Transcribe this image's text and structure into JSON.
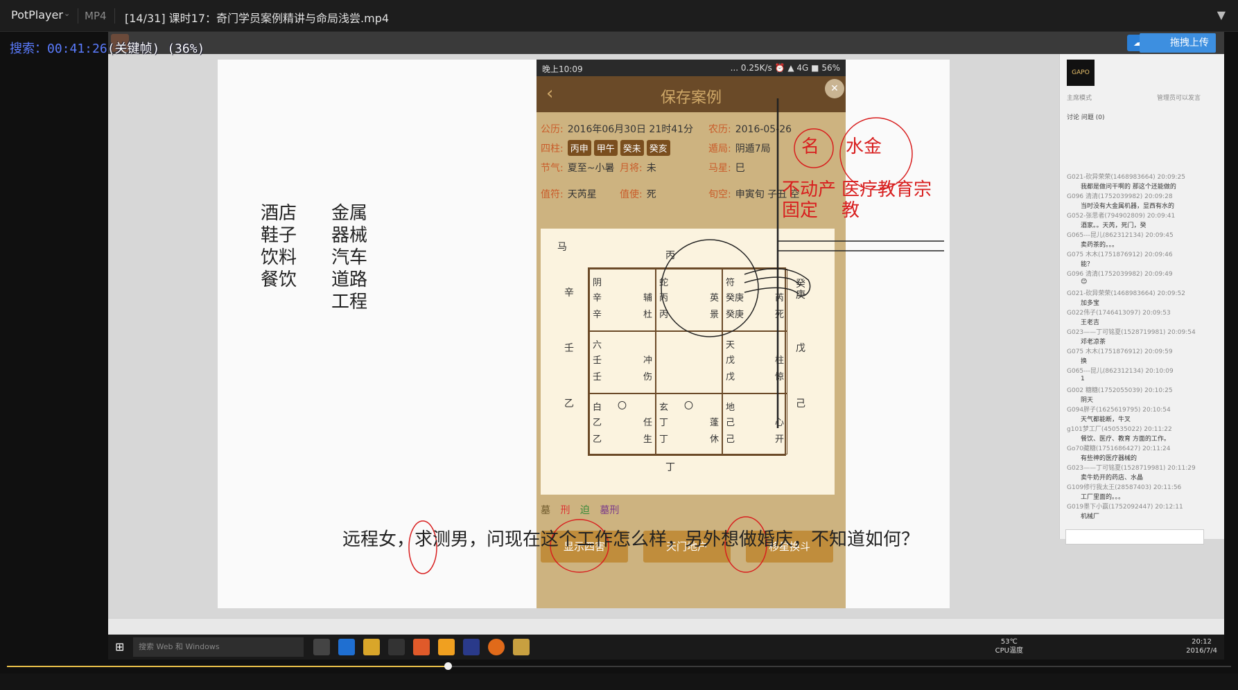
{
  "titlebar": {
    "app": "PotPlayer",
    "format": "MP4",
    "title": "[14/31] 课时17：奇门学员案例精讲与命局浅尝.mp4"
  },
  "search_overlay": {
    "label": "搜索：00:41:26",
    "status": "(关键帧) (36%)"
  },
  "video_topbar": {
    "upload_label": "拖拽上传"
  },
  "phone": {
    "status_time": "晚上10:09",
    "status_right": "... 0.25K/s ⏰ ▲ 4G ■ 56%",
    "header_title": "保存案例",
    "info": {
      "gongli_k": "公历:",
      "gongli_v": "2016年06月30日 21时41分",
      "nongli_k": "农历:",
      "nongli_v": "2016-05-26",
      "sizhu_k": "四柱:",
      "pillars": [
        "丙申",
        "甲午",
        "癸未",
        "癸亥"
      ],
      "dunju_k": "遁局:",
      "dunju_v": "阴遁7局",
      "jieqi_k": "节气:",
      "jieqi_v": "夏至~小暑",
      "yuejiang_k": "月将:",
      "yuejiang_v": "未",
      "maxing_k": "马星:",
      "maxing_v": "巳",
      "zhifu_k": "值符:",
      "zhifu_v": "天芮星",
      "zhishi_k": "值使:",
      "zhishi_v": "死",
      "xunkong_k": "旬空:",
      "xunkong_v": "申寅旬 子丑 空"
    },
    "board": {
      "ma": "马",
      "top": "丙",
      "bottom": "丁",
      "left": [
        "辛",
        "壬",
        "乙"
      ],
      "right": [
        "癸庚",
        "戊",
        "己"
      ],
      "cells": [
        [
          "阴",
          "辛",
          "辅",
          "辛",
          "杜"
        ],
        [
          "蛇",
          "丙",
          "英",
          "丙",
          "景"
        ],
        [
          "符",
          "癸庚",
          "芮",
          "癸庚",
          "死"
        ],
        [
          "六",
          "壬",
          "冲",
          "壬",
          "伤"
        ],
        [
          "",
          "",
          "",
          "",
          ""
        ],
        [
          "天",
          "戊",
          "柱",
          "戊",
          "惊"
        ],
        [
          "白",
          "乙",
          "任",
          "乙",
          "生"
        ],
        [
          "玄",
          "丁",
          "蓬",
          "丁",
          "休"
        ],
        [
          "地",
          "己",
          "心",
          "己",
          "开"
        ]
      ],
      "circle_mark": "〇"
    },
    "legend": [
      "墓",
      "刑",
      "迫",
      "墓刑"
    ],
    "buttons": [
      "显示四害",
      "天门地户",
      "移星换斗"
    ]
  },
  "annotations": {
    "left_col1": [
      "酒店",
      "鞋子",
      "饮料",
      "餐饮"
    ],
    "left_col2": [
      "金属",
      "器械",
      "汽车",
      "道路",
      "工程"
    ],
    "name_char": "名",
    "shuijin": "水金",
    "budongchan": "不动产",
    "guding": "固定",
    "yiliao": "医疗教育宗",
    "jiao": "教"
  },
  "subtitle": "远程女，求测男，问现在这个工作怎么样，另外想做婚庆，不知道如何？",
  "chat": {
    "mode": "主席模式",
    "admin_note": "管理员可以发言",
    "tabs": "讨论  问题 (0)",
    "lines": [
      [
        "G021-砍异荣荣(1468983664) 20:09:25",
        "我都是做问干啊的 那这个还能做的"
      ],
      [
        "G096 清清(1752039982) 20:09:28",
        "当时没有大金属机器，显西有水的"
      ],
      [
        "G052-张思者(794902809) 20:09:41",
        "酒家。。天芮，死门，癸"
      ],
      [
        "G065---昆儿(862312134) 20:09:45",
        "卖药茶的。。。"
      ],
      [
        "G075 木木(1751876912) 20:09:46",
        "能？"
      ],
      [
        "G096 清清(1752039982) 20:09:49",
        "😊"
      ],
      [
        "G021-砍异荣荣(1468983664) 20:09:52",
        "加多宝"
      ],
      [
        "G022伟子(1746413097) 20:09:53",
        "王老吉"
      ],
      [
        "G023——丁可铭夏(1528719981) 20:09:54",
        "邓老凉茶"
      ],
      [
        "G075 木木(1751876912) 20:09:59",
        "换"
      ],
      [
        "G065---昆儿(862312134) 20:10:09",
        "1"
      ],
      [
        "G002 糖糖(1752055039) 20:10:25",
        "阴天"
      ],
      [
        "G094胖子(1625619795) 20:10:54",
        "天气都能断，牛叉"
      ],
      [
        "g101梦工厂(450535022) 20:11:22",
        "餐饮、医疗、教育 方面的工作。"
      ],
      [
        "Go70藏糖(1751686427) 20:11:24",
        "有些神的医疗器械的"
      ],
      [
        "G023——丁可铭夏(1528719981) 20:11:29",
        "卖牛奶开的药店、水晶"
      ],
      [
        "G109修行我太王(28587403) 20:11:56",
        "工厂里面的。。。"
      ],
      [
        "G019墨下小赢(1752092447) 20:12:11",
        "机械厂"
      ]
    ]
  },
  "in_taskbar": {
    "search_placeholder": "搜索 Web 和 Windows",
    "cpu_temp": "53℃",
    "cpu_label": "CPU温度",
    "clock_time": "20:12",
    "clock_date": "2016/7/4"
  },
  "colors": {
    "accent_blue": "#3d8fe0",
    "progress": "#e8c04a",
    "phone_brown": "#6a4a28",
    "handwriting_red": "#d81e1e"
  },
  "progress": {
    "fraction": 0.36
  }
}
